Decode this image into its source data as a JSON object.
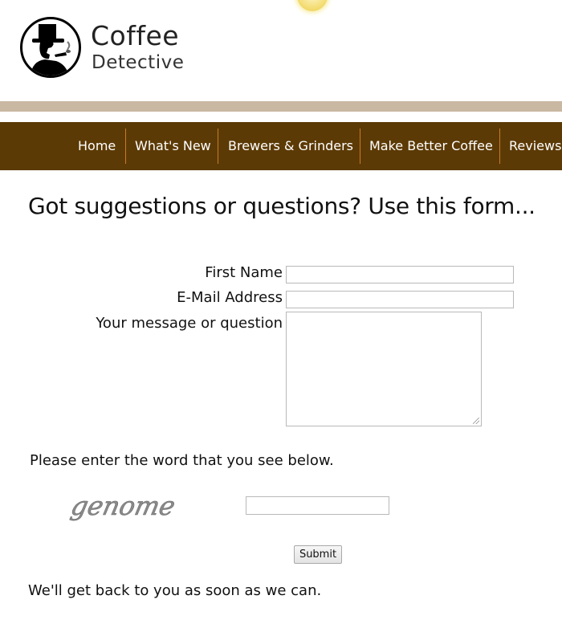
{
  "logo": {
    "line1": "Coffee",
    "line2": "Detective"
  },
  "nav": {
    "items": [
      {
        "label": "Home"
      },
      {
        "label": "What's New"
      },
      {
        "label": "Brewers & Grinders"
      },
      {
        "label": "Make Better Coffee"
      },
      {
        "label": "Reviews"
      }
    ]
  },
  "form": {
    "heading": "Got suggestions or questions? Use this form...",
    "first_name_label": "First Name",
    "first_name_value": "",
    "email_label": "E-Mail Address",
    "email_value": "",
    "message_label": "Your message or question",
    "message_value": "",
    "captcha_instruction": "Please enter the word that you see below.",
    "captcha_word": "genome",
    "captcha_value": "",
    "submit_label": "Submit"
  },
  "footer": {
    "text": "We'll get back to you as soon as we can."
  },
  "colors": {
    "nav_bg": "#5c3a05",
    "nav_separator": "#c97a2a",
    "tan_bar": "#c9b8a2"
  }
}
